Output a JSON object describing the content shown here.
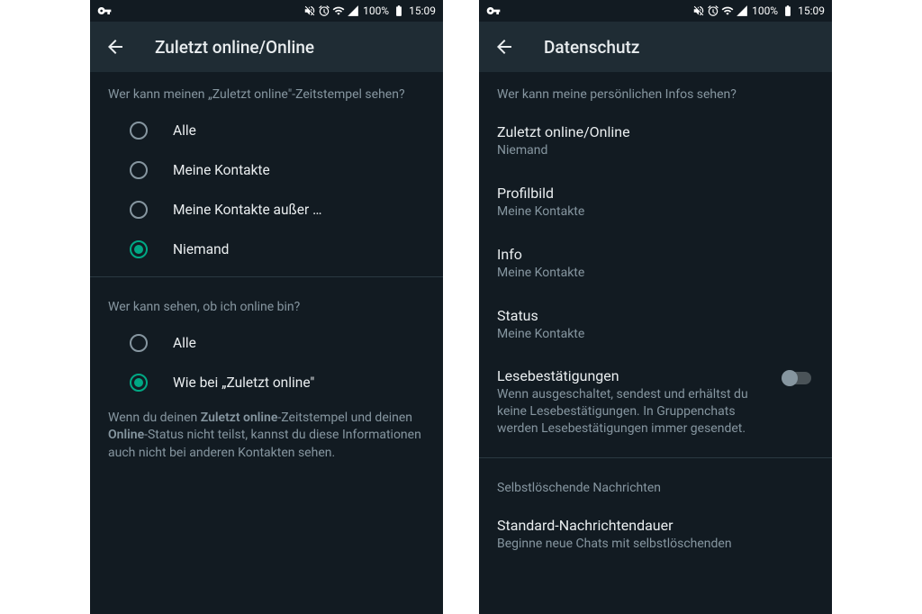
{
  "status": {
    "battery_pct": "100%",
    "time": "15:09"
  },
  "left": {
    "title": "Zuletzt online/Online",
    "section1_header": "Wer kann meinen „Zuletzt online\"-Zeitstempel sehen?",
    "options1": {
      "o0": "Alle",
      "o1": "Meine Kontakte",
      "o2": "Meine Kontakte außer …",
      "o3": "Niemand"
    },
    "section2_header": "Wer kann sehen, ob ich online bin?",
    "options2": {
      "o0": "Alle",
      "o1": "Wie bei „Zuletzt online\""
    },
    "info_prefix": "Wenn du deinen ",
    "info_b1": "Zuletzt online",
    "info_mid1": "-Zeitstempel und deinen ",
    "info_b2": "Online",
    "info_suffix": "-Status nicht teilst, kannst du diese Informationen auch nicht bei anderen Kontakten sehen."
  },
  "right": {
    "title": "Datenschutz",
    "section_header": "Wer kann meine persönlichen Infos sehen?",
    "items": {
      "last_seen": {
        "title": "Zuletzt online/Online",
        "sub": "Niemand"
      },
      "profile_pic": {
        "title": "Profilbild",
        "sub": "Meine Kontakte"
      },
      "about": {
        "title": "Info",
        "sub": "Meine Kontakte"
      },
      "status": {
        "title": "Status",
        "sub": "Meine Kontakte"
      }
    },
    "read_receipts": {
      "title": "Lesebestätigungen",
      "sub": "Wenn ausgeschaltet, sendest und erhältst du keine Lesebestätigungen. In Gruppenchats werden Lesebestätigungen immer gesendet."
    },
    "disappearing_header": "Selbstlöschende Nachrichten",
    "default_timer": {
      "title": "Standard-Nachrichtendauer",
      "sub": "Beginne neue Chats mit selbstlöschenden"
    }
  }
}
